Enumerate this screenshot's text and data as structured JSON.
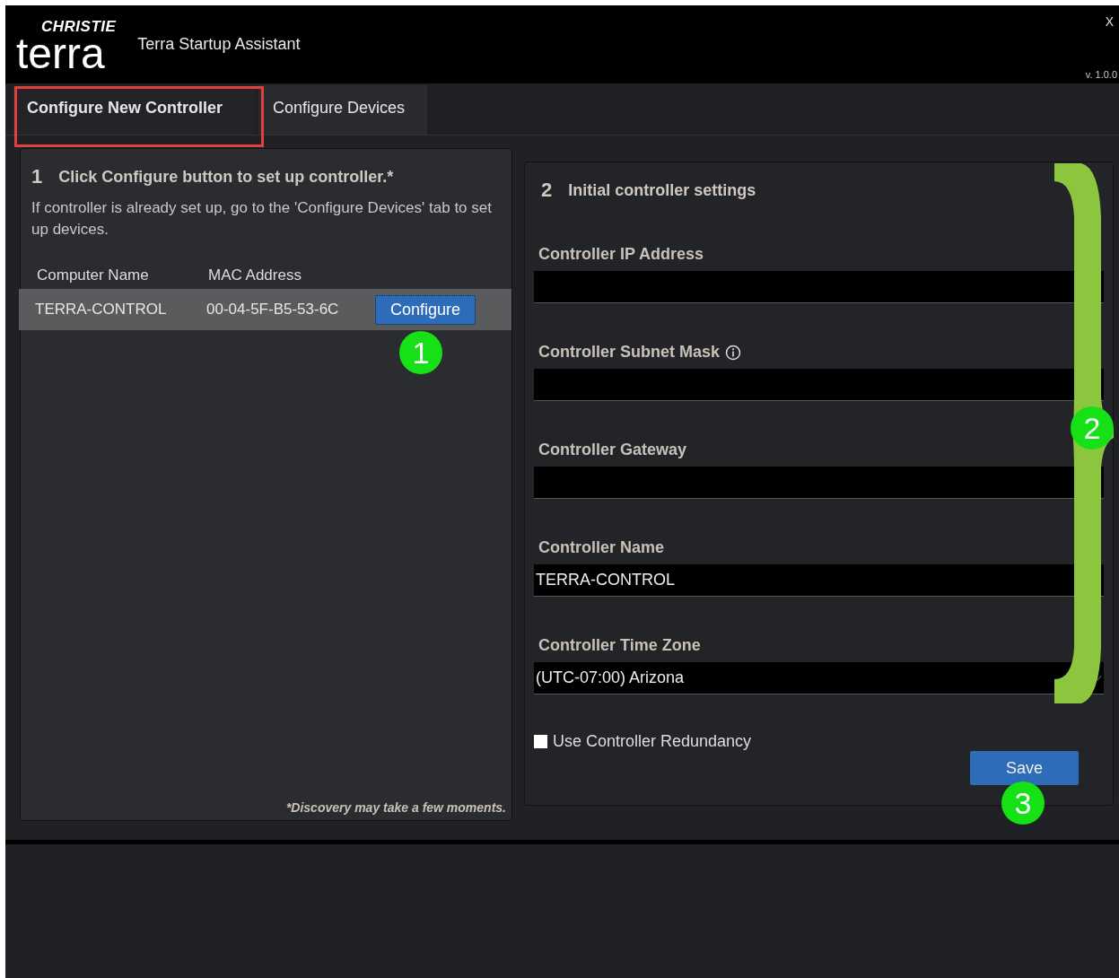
{
  "header": {
    "brand": "CHRISTIE",
    "logo": "terra",
    "title": "Terra Startup Assistant",
    "close": "X",
    "version": "v. 1.0.0"
  },
  "tabs": [
    {
      "label": "Configure New Controller",
      "selected": true,
      "highlighted": true
    },
    {
      "label": "Configure Devices",
      "selected": false,
      "highlighted": false
    }
  ],
  "step1": {
    "number": "1",
    "title": "Click Configure button to set up controller.*",
    "description": "If controller is already set up, go to the 'Configure Devices' tab to set up devices.",
    "columns": [
      "Computer Name",
      "MAC Address"
    ],
    "rows": [
      {
        "computer_name": "TERRA-CONTROL",
        "mac_address": "00-04-5F-B5-53-6C",
        "button": "Configure",
        "selected": true
      }
    ],
    "footnote": "*Discovery may take a few moments."
  },
  "step2": {
    "number": "2",
    "title": "Initial controller settings",
    "fields": [
      {
        "label": "Controller IP Address",
        "kind": "text"
      },
      {
        "label": "Controller Subnet Mask",
        "kind": "text",
        "info": true
      },
      {
        "label": "Controller Gateway",
        "kind": "text"
      },
      {
        "label": "Controller Name",
        "kind": "text",
        "value": "TERRA-CONTROL"
      },
      {
        "label": "Controller Time Zone",
        "kind": "select",
        "value": "(UTC-07:00) Arizona"
      }
    ],
    "redundancy": {
      "label": "Use Controller Redundancy",
      "checked": false
    },
    "save": "Save"
  },
  "callouts": [
    {
      "label": "1"
    },
    {
      "label": "2"
    },
    {
      "label": "3"
    }
  ]
}
